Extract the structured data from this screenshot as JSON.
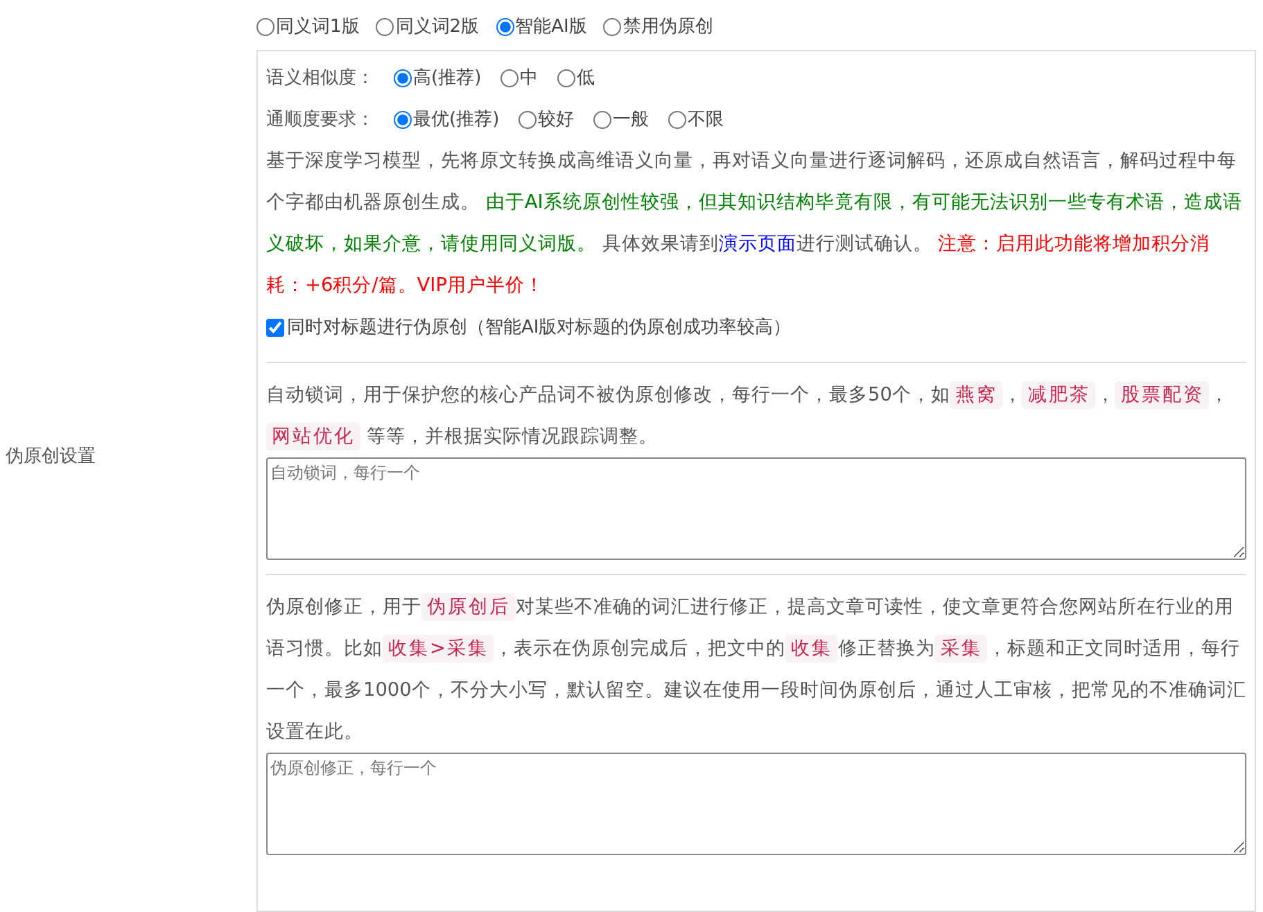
{
  "section_label": "伪原创设置",
  "modes": [
    {
      "label": "同义词1版",
      "selected": false
    },
    {
      "label": "同义词2版",
      "selected": false
    },
    {
      "label": "智能AI版",
      "selected": true
    },
    {
      "label": "禁用伪原创",
      "selected": false
    }
  ],
  "similarity": {
    "label": "语义相似度：",
    "options": [
      {
        "label": "高(推荐)",
        "selected": true
      },
      {
        "label": "中",
        "selected": false
      },
      {
        "label": "低",
        "selected": false
      }
    ]
  },
  "fluency": {
    "label": "通顺度要求：",
    "options": [
      {
        "label": "最优(推荐)",
        "selected": true
      },
      {
        "label": "较好",
        "selected": false
      },
      {
        "label": "一般",
        "selected": false
      },
      {
        "label": "不限",
        "selected": false
      }
    ]
  },
  "description": [
    {
      "kind": "plain",
      "text": "基于深度学习模型，先将原文转换成高维语义向量，再对语义向量进行逐词解码，还原成自然语言，解码过程中每个字都由机器原创生成。 "
    },
    {
      "kind": "notice",
      "text": "由于AI系统原创性较强，但其知识结构毕竟有限，有可能无法识别一些专有术语，造成语义破坏，如果介意，请使用同义词版。"
    },
    {
      "kind": "plain",
      "text": " 具体效果请到"
    },
    {
      "kind": "link",
      "text": "演示页面"
    },
    {
      "kind": "plain",
      "text": "进行测试确认。 "
    },
    {
      "kind": "warning",
      "text": "注意：启用此功能将增加积分消耗：+6积分/篇。VIP用户半价！"
    }
  ],
  "title_option": {
    "label": "同时对标题进行伪原创（智能AI版对标题的伪原创成功率较高）",
    "checked": true
  },
  "lock_words": {
    "help": [
      {
        "kind": "plain",
        "text": "自动锁词，用于保护您的核心产品词不被伪原创修改，每行一个，最多50个，如"
      },
      {
        "kind": "code",
        "text": "燕窝"
      },
      {
        "kind": "plain",
        "text": "，"
      },
      {
        "kind": "code",
        "text": "减肥茶"
      },
      {
        "kind": "plain",
        "text": "，"
      },
      {
        "kind": "code",
        "text": "股票配资"
      },
      {
        "kind": "plain",
        "text": "，"
      },
      {
        "kind": "code",
        "text": "网站优化"
      },
      {
        "kind": "plain",
        "text": " 等等，并根据实际情况跟踪调整。"
      }
    ],
    "placeholder": "自动锁词，每行一个"
  },
  "corrections": {
    "help": [
      {
        "kind": "plain",
        "text": "伪原创修正，用于"
      },
      {
        "kind": "code",
        "text": "伪原创后"
      },
      {
        "kind": "plain",
        "text": "对某些不准确的词汇进行修正，提高文章可读性，使文章更符合您网站所在行业的用语习惯。比如"
      },
      {
        "kind": "code",
        "text": "收集>采集"
      },
      {
        "kind": "plain",
        "text": "，表示在伪原创完成后，把文中的"
      },
      {
        "kind": "code",
        "text": "收集"
      },
      {
        "kind": "plain",
        "text": "修正替换为"
      },
      {
        "kind": "code",
        "text": "采集"
      },
      {
        "kind": "plain",
        "text": "，标题和正文同时适用，每行一个，最多1000个，不分大小写，默认留空。建议在使用一段时间伪原创后，通过人工审核，把常见的不准确词汇设置在此。"
      }
    ],
    "placeholder": "伪原创修正，每行一个"
  }
}
